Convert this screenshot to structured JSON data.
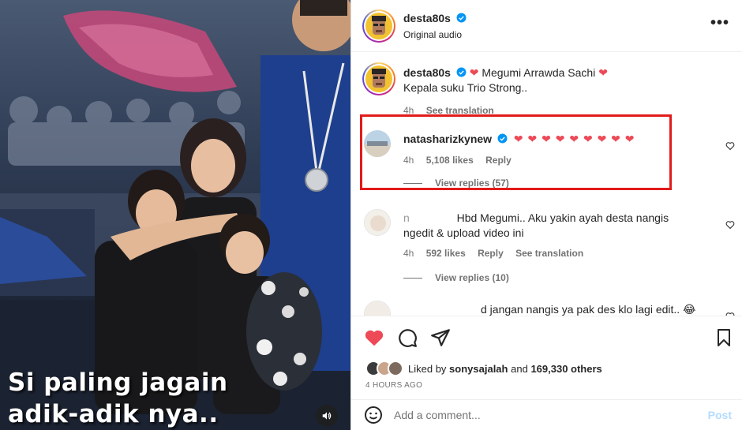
{
  "video": {
    "caption_lines": [
      "Si paling jagain",
      "adik-adik nya.."
    ],
    "mute_icon": "speaker-icon"
  },
  "header": {
    "username": "desta80s",
    "audio": "Original audio",
    "more_icon": "more-horizontal-icon"
  },
  "caption_comment": {
    "username": "desta80s",
    "text_line1": "Megumi Arrawda Sachi",
    "text_line2": "Kepala suku Trio Strong..",
    "time": "4h",
    "translate": "See translation"
  },
  "comments": [
    {
      "username": "natasharizkynew",
      "text": "❤ ❤ ❤ ❤ ❤ ❤ ❤ ❤ ❤",
      "time": "4h",
      "likes": "5,108 likes",
      "reply": "Reply",
      "view_replies": "View replies (57)"
    },
    {
      "username": "n",
      "text": "Hbd Megumi.. Aku yakin ayah desta nangis ngedit & upload video ini",
      "time": "4h",
      "likes": "592 likes",
      "reply": "Reply",
      "translate": "See translation",
      "view_replies": "View replies (10)"
    },
    {
      "text": "d jangan nangis ya pak des klo lagi edit.."
    }
  ],
  "actions": {
    "like_icon": "heart-filled-icon",
    "comment_icon": "comment-icon",
    "share_icon": "share-icon",
    "save_icon": "bookmark-icon",
    "liked_by_prefix": "Liked by",
    "liked_by_user": "sonysajalah",
    "liked_by_suffix": "and",
    "others": "169,330 others",
    "time": "4 HOURS AGO"
  },
  "add_comment": {
    "placeholder": "Add a comment...",
    "post": "Post",
    "emoji_icon": "emoji-icon"
  },
  "colors": {
    "accent_red": "#ed4956",
    "highlight_box": "#e21b1b",
    "verified_blue": "#0095f6",
    "post_disabled": "#b3dbff"
  }
}
